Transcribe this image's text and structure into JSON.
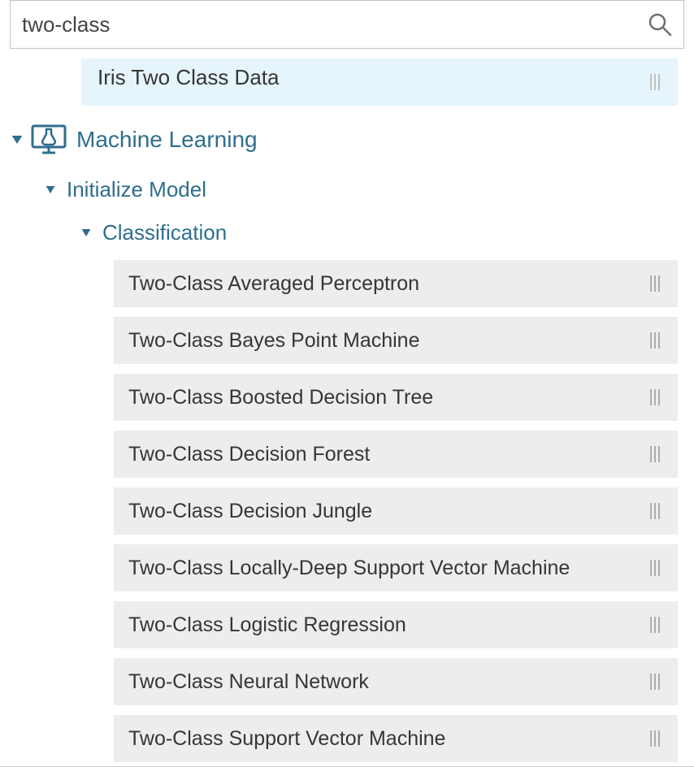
{
  "search": {
    "value": "two-class",
    "placeholder": ""
  },
  "dataItem": {
    "label": "Iris Two Class Data"
  },
  "categories": {
    "ml": {
      "label": "Machine Learning",
      "expanded": true
    },
    "init": {
      "label": "Initialize Model",
      "expanded": true
    },
    "class": {
      "label": "Classification",
      "expanded": true
    }
  },
  "modules": [
    {
      "label": "Two-Class Averaged Perceptron"
    },
    {
      "label": "Two-Class Bayes Point Machine"
    },
    {
      "label": "Two-Class Boosted Decision Tree"
    },
    {
      "label": "Two-Class Decision Forest"
    },
    {
      "label": "Two-Class Decision Jungle"
    },
    {
      "label": "Two-Class Locally-Deep Support Vector Machine"
    },
    {
      "label": "Two-Class Logistic Regression"
    },
    {
      "label": "Two-Class Neural Network"
    },
    {
      "label": "Two-Class Support Vector Machine"
    }
  ],
  "colors": {
    "accent": "#2f6e8c",
    "itemBg": "#ededed",
    "highlightBg": "#e6f5fb"
  }
}
